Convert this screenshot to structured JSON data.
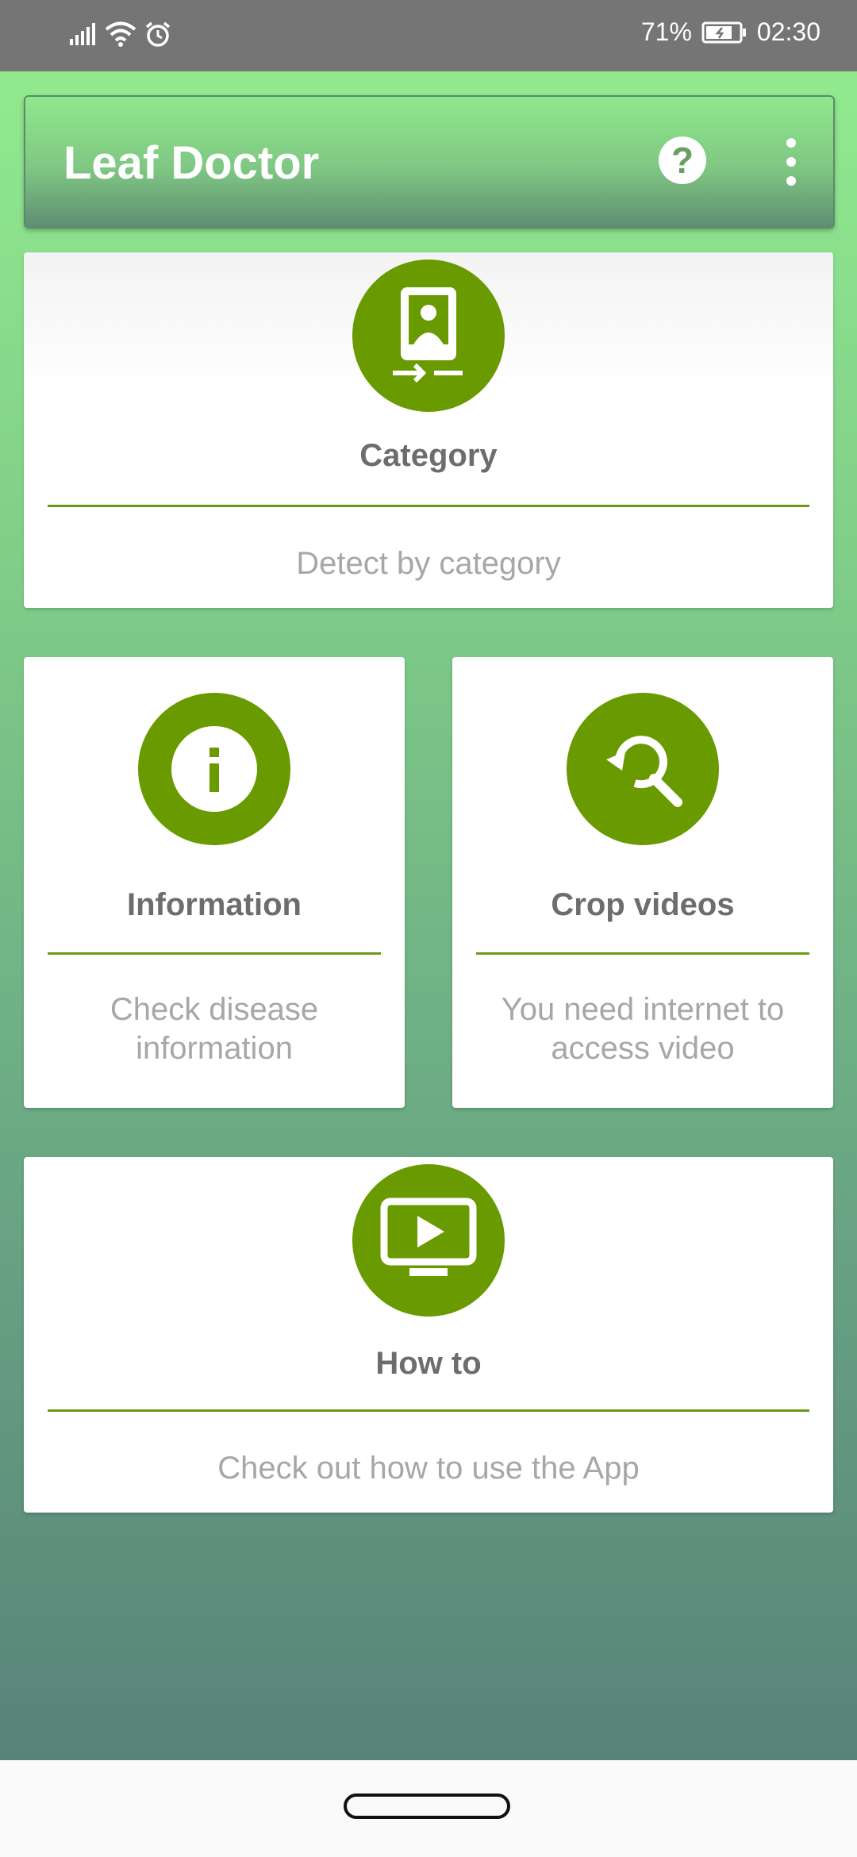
{
  "status_bar": {
    "battery_percent": "71%",
    "time": "02:30",
    "icons": [
      "signal-icon",
      "wifi-icon",
      "alarm-icon",
      "battery-icon"
    ]
  },
  "toolbar": {
    "title": "Leaf Doctor",
    "help_icon": "question-circle-icon",
    "menu_icon": "more-vert-icon"
  },
  "cards": {
    "category": {
      "title": "Category",
      "description": "Detect by category",
      "icon": "camera-switch-icon"
    },
    "information": {
      "title": "Information",
      "description_line1": "Check disease",
      "description_line2": "information",
      "icon": "info-icon"
    },
    "crop_videos": {
      "title": "Crop videos",
      "description_line1": "You need internet to",
      "description_line2": "access video",
      "icon": "search-refresh-icon"
    },
    "how_to": {
      "title": "How to",
      "description": "Check out how to use the App",
      "icon": "video-play-icon"
    }
  },
  "colors": {
    "accent": "#699a00",
    "toolbar_gradient_top": "#8fe88c",
    "background_bottom": "#588379"
  }
}
